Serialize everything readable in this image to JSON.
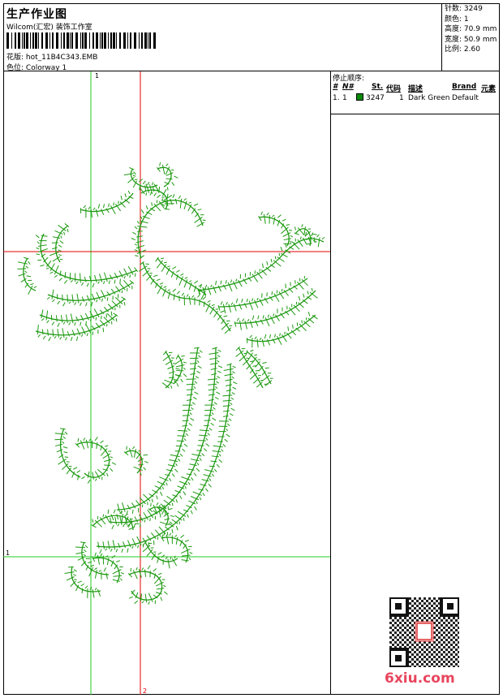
{
  "header": {
    "title": "生产作业图",
    "studio": "Wilcom(汇宏) 装饰工作室",
    "design_label": "花版:",
    "design_value": "hot_11B4C343.EMB",
    "colorway_label": "色位:",
    "colorway_value": "Colorway 1"
  },
  "stats": [
    {
      "label": "针数:",
      "value": "3249"
    },
    {
      "label": "颜色:",
      "value": "1"
    },
    {
      "label": "高度:",
      "value": "70.9 mm"
    },
    {
      "label": "宽度:",
      "value": "50.9 mm"
    },
    {
      "label": "比例:",
      "value": "2.60"
    }
  ],
  "stop_sequence": {
    "title": "停止顺序:",
    "columns": [
      "#",
      "N#",
      "St.",
      "代码",
      "描述",
      "Brand",
      "元素"
    ],
    "rows": [
      {
        "index": "1.",
        "needle": "1",
        "stitches": "3247",
        "code": "1",
        "description": "Dark Green",
        "brand": "Default",
        "swatch_color": "#0a8a0a"
      }
    ]
  },
  "guides": {
    "vertical_1": "1",
    "vertical_2": "2",
    "horizontal_1": "1"
  },
  "colors": {
    "thread": "#1e9a12",
    "guide_green": "#22cc22",
    "guide_red": "#e00000"
  },
  "watermark": {
    "text": "6xiu.com",
    "icon": "qr-code-icon"
  }
}
